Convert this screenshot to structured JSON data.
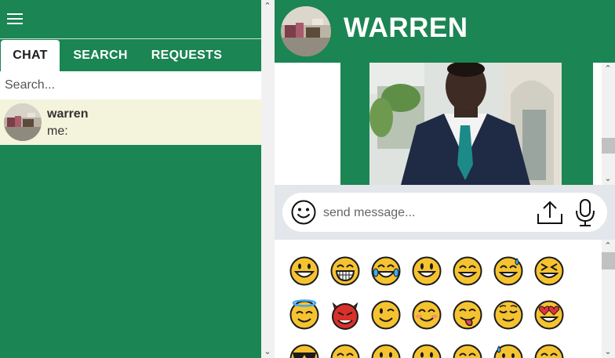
{
  "sidebar": {
    "tabs": [
      {
        "label": "CHAT",
        "active": true
      },
      {
        "label": "SEARCH",
        "active": false
      },
      {
        "label": "REQUESTS",
        "active": false
      }
    ],
    "search_placeholder": "Search...",
    "chats": [
      {
        "name": "warren",
        "preview": "me:"
      }
    ]
  },
  "conversation": {
    "title": "WARREN",
    "input_placeholder": "send message..."
  },
  "emoji_rows": [
    [
      "grinning",
      "beaming",
      "tears-of-joy",
      "grin-big",
      "smile",
      "sweat-smile",
      "squinting"
    ],
    [
      "halo",
      "devil",
      "wink",
      "blush",
      "yum",
      "relieved",
      "heart-eyes"
    ],
    [
      "sunglasses",
      "smile",
      "neutral",
      "neutral",
      "smile",
      "sweat",
      "smile"
    ]
  ],
  "colors": {
    "brand_green": "#1b8553",
    "active_chat_bg": "#f4f3dc",
    "input_bar_bg": "#e3e6ea",
    "emoji_yellow": "#f6c330"
  }
}
